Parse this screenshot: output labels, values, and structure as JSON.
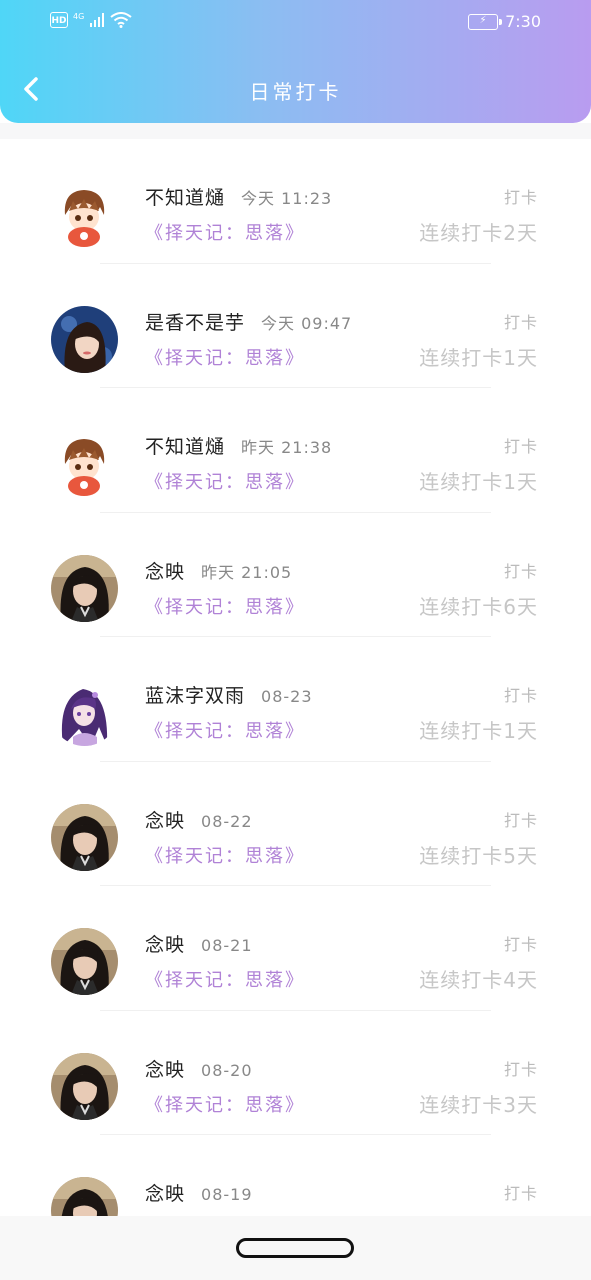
{
  "status_bar": {
    "hd": "HD",
    "network": "4G",
    "time": "7:30",
    "icons": [
      "signal-icon",
      "wifi-icon",
      "battery-charging-icon"
    ]
  },
  "header": {
    "title": "日常打卡",
    "back_icon": "back-arrow-icon",
    "gradient": [
      "#4fd6f7",
      "#b99cf0"
    ]
  },
  "colors": {
    "book_text": "#b082d6",
    "streak_text": "#c6c6c6"
  },
  "records": [
    {
      "name": "不知道熥",
      "time": "今天 11:23",
      "book": "《择天记：思落》",
      "action": "打卡",
      "streak": "连续打卡2天",
      "avatar": "anime-boy"
    },
    {
      "name": "是香不是芋",
      "time": "今天 09:47",
      "book": "《择天记：思落》",
      "action": "打卡",
      "streak": "连续打卡1天",
      "avatar": "girl-photo-blue"
    },
    {
      "name": "不知道熥",
      "time": "昨天 21:38",
      "book": "《择天记：思落》",
      "action": "打卡",
      "streak": "连续打卡1天",
      "avatar": "anime-boy"
    },
    {
      "name": "念映",
      "time": "昨天 21:05",
      "book": "《择天记：思落》",
      "action": "打卡",
      "streak": "连续打卡6天",
      "avatar": "girl-photo-dark"
    },
    {
      "name": "蓝沫字双雨",
      "time": "08-23",
      "book": "《择天记：思落》",
      "action": "打卡",
      "streak": "连续打卡1天",
      "avatar": "anime-girl-purple"
    },
    {
      "name": "念映",
      "time": "08-22",
      "book": "《择天记：思落》",
      "action": "打卡",
      "streak": "连续打卡5天",
      "avatar": "girl-photo-dark"
    },
    {
      "name": "念映",
      "time": "08-21",
      "book": "《择天记：思落》",
      "action": "打卡",
      "streak": "连续打卡4天",
      "avatar": "girl-photo-dark"
    },
    {
      "name": "念映",
      "time": "08-20",
      "book": "《择天记：思落》",
      "action": "打卡",
      "streak": "连续打卡3天",
      "avatar": "girl-photo-dark"
    },
    {
      "name": "念映",
      "time": "08-19",
      "book": "",
      "action": "打卡",
      "streak": "",
      "avatar": "girl-photo-dark"
    }
  ]
}
